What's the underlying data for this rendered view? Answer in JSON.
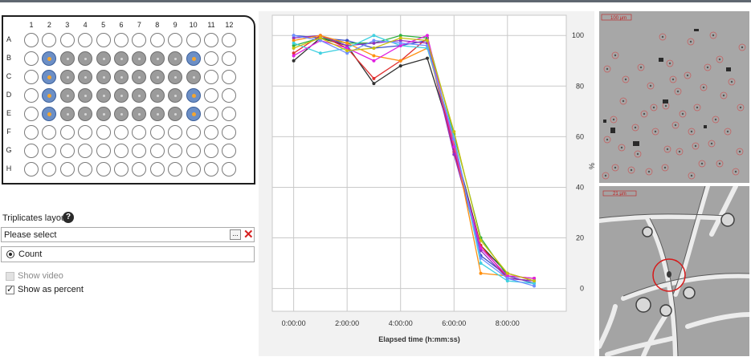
{
  "plate": {
    "columns": [
      "1",
      "2",
      "3",
      "4",
      "5",
      "6",
      "7",
      "8",
      "9",
      "10",
      "11",
      "12"
    ],
    "rows": [
      "A",
      "B",
      "C",
      "D",
      "E",
      "F",
      "G",
      "H"
    ],
    "well_states": {
      "B": [
        "empty",
        "selected",
        "filled",
        "filled",
        "filled",
        "filled",
        "filled",
        "filled",
        "filled",
        "selected",
        "empty",
        "empty"
      ],
      "C": [
        "empty",
        "selected",
        "filled",
        "filled",
        "filled",
        "filled",
        "filled",
        "filled",
        "filled",
        "filled",
        "empty",
        "empty"
      ],
      "D": [
        "empty",
        "selected",
        "filled",
        "filled",
        "filled",
        "filled",
        "filled",
        "filled",
        "filled",
        "selected",
        "empty",
        "empty"
      ],
      "E": [
        "empty",
        "selected",
        "filled",
        "filled",
        "filled",
        "filled",
        "filled",
        "filled",
        "filled",
        "selected",
        "empty",
        "empty"
      ]
    },
    "colors": {
      "filled": "#9b9b9b",
      "selected": "#6c8fc6",
      "marker": "#f2a531"
    }
  },
  "controls": {
    "triplicates_label": "Triplicates layout",
    "help_glyph": "?",
    "select_placeholder": "Please select",
    "browse_label": "...",
    "clear_glyph": "✕",
    "count_label": "Count",
    "show_video_label": "Show video",
    "show_video_checked": false,
    "show_video_enabled": false,
    "show_percent_label": "Show as percent",
    "show_percent_checked": true
  },
  "chart_data": {
    "type": "line",
    "xlabel": "Elapsed time (h:mm:ss)",
    "ylabel": "%",
    "x_hours": [
      0,
      1,
      2,
      3,
      4,
      5,
      6,
      7,
      8,
      9
    ],
    "x_tick_labels": [
      "0:00:00",
      "2:00:00",
      "4:00:00",
      "6:00:00",
      "8:00:00"
    ],
    "x_tick_hours": [
      0,
      2,
      4,
      6,
      8
    ],
    "xlim_hours": [
      -0.8,
      10.2
    ],
    "y_ticks": [
      0,
      20,
      40,
      60,
      80,
      100
    ],
    "ylim": [
      -9,
      108
    ],
    "y_axis_side": "right",
    "grid": true,
    "series": [
      {
        "color": "#303030",
        "values": [
          90,
          99,
          96,
          81,
          88,
          91,
          57,
          17,
          6,
          3
        ]
      },
      {
        "color": "#3a50c8",
        "values": [
          100,
          99,
          98,
          95,
          96,
          98,
          55,
          13,
          5,
          2
        ]
      },
      {
        "color": "#e03030",
        "values": [
          93,
          100,
          95,
          83,
          90,
          99,
          54,
          17,
          4,
          3
        ]
      },
      {
        "color": "#30b040",
        "values": [
          96,
          99,
          97,
          97,
          100,
          99,
          61,
          20,
          5,
          4
        ]
      },
      {
        "color": "#9030c0",
        "values": [
          99,
          100,
          96,
          97,
          98,
          97,
          53,
          15,
          4,
          3
        ]
      },
      {
        "color": "#ff9010",
        "values": [
          98,
          100,
          97,
          92,
          90,
          95,
          58,
          6,
          5,
          4
        ]
      },
      {
        "color": "#40d0e0",
        "values": [
          97,
          93,
          95,
          100,
          96,
          95,
          60,
          10,
          3,
          2
        ]
      },
      {
        "color": "#e020e0",
        "values": [
          92,
          98,
          95,
          90,
          96,
          100,
          56,
          16,
          5,
          4
        ]
      },
      {
        "color": "#7090ff",
        "values": [
          100,
          98,
          93,
          98,
          97,
          96,
          59,
          12,
          4,
          1
        ]
      },
      {
        "color": "#c8c010",
        "values": [
          95,
          99,
          94,
          95,
          99,
          98,
          62,
          19,
          6,
          3
        ]
      }
    ]
  },
  "images": {
    "top_scale_label": "100 µm",
    "bottom_scale_label": "21 µm"
  }
}
